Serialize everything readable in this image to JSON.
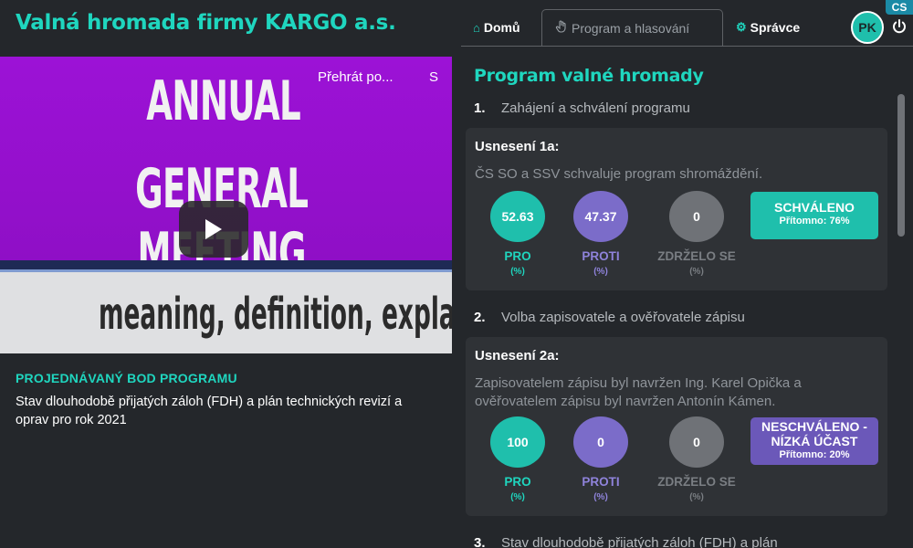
{
  "app": {
    "title": "Valná hromada firmy KARGO a.s."
  },
  "video": {
    "caption_line1": "ANNUAL",
    "caption_line2": "GENERAL MEETING",
    "caption_line3": "meaning, definition, explanation...",
    "title_overlay": "Přehrát po...",
    "share_overlay": "S"
  },
  "current_item": {
    "label": "PROJEDNÁVANÝ BOD PROGRAMU",
    "text": "Stav dlouhodobě přijatých záloh (FDH) a plán technických revizí a oprav pro rok 2021"
  },
  "header": {
    "tabs": [
      {
        "label": "Domů",
        "icon": "home-icon"
      },
      {
        "label": "Program a hlasování",
        "icon": "hand-icon"
      },
      {
        "label": "Správce",
        "icon": "gear-icon"
      }
    ],
    "avatar": "PK",
    "lang": "CS"
  },
  "program": {
    "title": "Program valné hromady",
    "items": [
      {
        "num": "1.",
        "title": "Zahájení a schválení programu",
        "resolution": {
          "title": "Usnesení 1a:",
          "text": "ČS SO a SSV schvaluje program shromáždění.",
          "pro": "52.63",
          "proti": "47.37",
          "zdrzelo": "0",
          "status": "SCHVÁLENO",
          "attendance": "Přítomno: 76%"
        }
      },
      {
        "num": "2.",
        "title": "Volba zapisovatele a ověřovatele zápisu",
        "resolution": {
          "title": "Usnesení 2a:",
          "text": "Zapisovatelem zápisu byl navržen Ing. Karel Opička a ověřovatelem zápisu byl navržen Antonín Kámen.",
          "pro": "100",
          "proti": "0",
          "zdrzelo": "0",
          "status": "NESCHVÁLENO - NÍZKÁ ÚČAST",
          "attendance": "Přítomno: 20%"
        }
      },
      {
        "num": "3.",
        "title": "Stav dlouhodobě přijatých záloh (FDH) a plán"
      }
    ],
    "labels": {
      "pro": "PRO",
      "proti": "PROTI",
      "zdrzelo": "ZDRŽELO SE",
      "unit": "(%)"
    }
  },
  "colors": {
    "accent": "#1fd6bf",
    "proti": "#7b6cc9",
    "background": "#24272b",
    "card": "#2f3236"
  }
}
